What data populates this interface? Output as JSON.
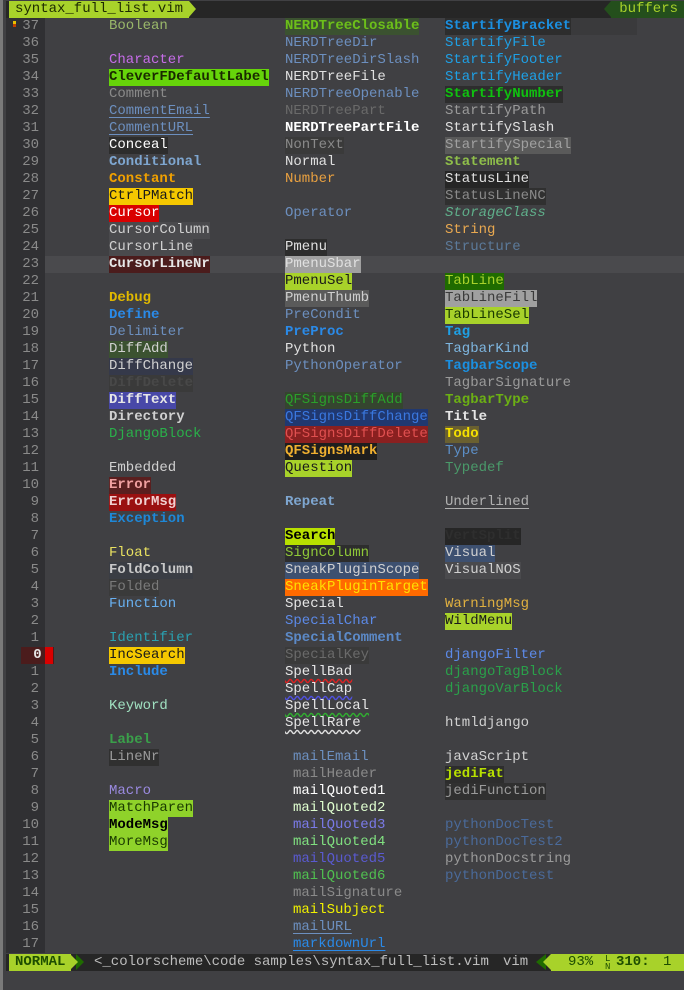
{
  "tabline": {
    "active_tab": "syntax_full_list.vim",
    "buffers_label": "buffers"
  },
  "statusline": {
    "mode": "NORMAL",
    "filepath": "<_colorscheme\\code samples\\syntax_full_list.vim",
    "filetype": "vim",
    "percent": "93%",
    "line_icon": "ln-icon",
    "line": "310:",
    "column": "1"
  },
  "colors": {
    "accent": "#a8d22a",
    "accent_dark": "#244f1c",
    "background": "#404043",
    "gutter": "#303033"
  },
  "rows": [
    {
      "lnr": "37",
      "c1": {
        "t": "Boolean",
        "fg": "#9ab86a"
      },
      "c2": {
        "t": "NERDTreeClosable",
        "fg": "#6cbf1a",
        "bg": "#3b5230",
        "b": true
      },
      "c3": {
        "t": "StartifyBracket",
        "fg": "#1b8fe0",
        "bg": "#2d2d2d",
        "b": true
      },
      "cursorline_partial": true
    },
    {
      "lnr": "36",
      "c2": {
        "t": "NERDTreeDir",
        "fg": "#6c8fbf"
      },
      "c3": {
        "t": "StartifyFile",
        "fg": "#1ea0e6"
      }
    },
    {
      "lnr": "35",
      "c1": {
        "t": "Character",
        "fg": "#c66ce8"
      },
      "c2": {
        "t": "NERDTreeDirSlash",
        "fg": "#6c8fbf"
      },
      "c3": {
        "t": "StartifyFooter",
        "fg": "#1ea0e6"
      }
    },
    {
      "lnr": "34",
      "c1": {
        "t": "CleverFDefaultLabel",
        "fg": "#1a2a00",
        "bg": "#66d40a",
        "b": true
      },
      "c2": {
        "t": "NERDTreeFile",
        "fg": "#e0e0e0"
      },
      "c3": {
        "t": "StartifyHeader",
        "fg": "#1ea0e6"
      }
    },
    {
      "lnr": "33",
      "c1": {
        "t": "Comment",
        "fg": "#8a8a8a"
      },
      "c2": {
        "t": "NERDTreeOpenable",
        "fg": "#6c8fbf"
      },
      "c3": {
        "t": "StartifyNumber",
        "fg": "#10c010",
        "bg": "#2d2d2d",
        "b": true
      }
    },
    {
      "lnr": "32",
      "c1": {
        "t": "CommentEmail",
        "fg": "#6c8fbf",
        "u": "#6c8fbf"
      },
      "c2": {
        "t": "NERDTreePart",
        "fg": "#6a6a6a"
      },
      "c3": {
        "t": "StartifyPath",
        "fg": "#9a9a9a"
      }
    },
    {
      "lnr": "31",
      "c1": {
        "t": "CommentURL",
        "fg": "#6c8fbf",
        "u": "#6c8fbf"
      },
      "c2": {
        "t": "NERDTreePartFile",
        "fg": "#ffffff",
        "b": true
      },
      "c3": {
        "t": "StartifySlash",
        "fg": "#e0e0e0"
      }
    },
    {
      "lnr": "30",
      "c1": {
        "t": "Conceal",
        "fg": "#ffffff",
        "bg": "#2d2d2d"
      },
      "c2": {
        "t": "NonText",
        "fg": "#8a8a8a",
        "bg": "#3a3a3a"
      },
      "c3": {
        "t": "StartifySpecial",
        "fg": "#a0a0a0",
        "bg": "#5a5a5a"
      }
    },
    {
      "lnr": "29",
      "c1": {
        "t": "Conditional",
        "fg": "#7ea6d0",
        "b": true
      },
      "c2": {
        "t": "Normal",
        "fg": "#e0e0e0"
      },
      "c3": {
        "t": "Statement",
        "fg": "#8fbf4a",
        "b": true
      }
    },
    {
      "lnr": "28",
      "c1": {
        "t": "Constant",
        "fg": "#f0a000",
        "b": true
      },
      "c2": {
        "t": "Number",
        "fg": "#e8a040"
      },
      "c3": {
        "t": "StatusLine",
        "fg": "#e0e0e0",
        "bg": "#262626"
      }
    },
    {
      "lnr": "27",
      "c1": {
        "t": "CtrlPMatch",
        "fg": "#1a1a1a",
        "bg": "#f5c800"
      },
      "c3": {
        "t": "StatusLineNC",
        "fg": "#8a8a8a",
        "bg": "#303030"
      }
    },
    {
      "lnr": "26",
      "c1": {
        "t": "Cursor",
        "fg": "#ffffff",
        "bg": "#d90000"
      },
      "c2": {
        "t": "Operator",
        "fg": "#6c8fbf"
      },
      "c3": {
        "t": "StorageClass",
        "fg": "#5fae8a",
        "i": true
      }
    },
    {
      "lnr": "25",
      "c1": {
        "t": "CursorColumn",
        "fg": "#d0d0d0",
        "bg": "#4a4a4d"
      },
      "c3": {
        "t": "String",
        "fg": "#e8a850"
      }
    },
    {
      "lnr": "24",
      "c1": {
        "t": "CursorLine",
        "fg": "#d0d0d0",
        "bg": "#4a4a4d"
      },
      "c2": {
        "t": "Pmenu",
        "fg": "#e0e0e0",
        "bg": "#2d2d2d"
      },
      "c3": {
        "t": "Structure",
        "fg": "#5c7a9a"
      }
    },
    {
      "lnr": "23",
      "c1": {
        "t": "CursorLineNr",
        "fg": "#e6e6e6",
        "bg": "#4b1c1c",
        "b": true
      },
      "c2": {
        "t": "PmenuSbar",
        "fg": "#e0e0e0",
        "bg": "#a0a0a0"
      },
      "cursorline": true
    },
    {
      "lnr": "22",
      "c2": {
        "t": "PmenuSel",
        "fg": "#1a1a1a",
        "bg": "#a8d22a"
      },
      "c3": {
        "t": "TabLine",
        "fg": "#a8d22a",
        "bg": "#1f6b00"
      }
    },
    {
      "lnr": "21",
      "c1": {
        "t": "Debug",
        "fg": "#e0b800",
        "b": true
      },
      "c2": {
        "t": "PmenuThumb",
        "fg": "#d0d0d0",
        "bg": "#5a5a5a"
      },
      "c3": {
        "t": "TabLineFill",
        "fg": "#3a3a3a",
        "bg": "#a0a0a0"
      }
    },
    {
      "lnr": "20",
      "c1": {
        "t": "Define",
        "fg": "#2a8ae8",
        "b": true
      },
      "c2": {
        "t": "PreCondit",
        "fg": "#6c8fbf"
      },
      "c3": {
        "t": "TabLineSel",
        "fg": "#1a3a00",
        "bg": "#a8d22a"
      }
    },
    {
      "lnr": "19",
      "c1": {
        "t": "Delimiter",
        "fg": "#6c8fbf"
      },
      "c2": {
        "t": "PreProc",
        "fg": "#2a8ae8",
        "b": true
      },
      "c3": {
        "t": "Tag",
        "fg": "#1ea0e6",
        "b": true
      }
    },
    {
      "lnr": "18",
      "c1": {
        "t": "DiffAdd",
        "fg": "#d0d0d0",
        "bg": "#3b5230"
      },
      "c2": {
        "t": "Python",
        "fg": "#e0e0e0"
      },
      "c3": {
        "t": "TagbarKind",
        "fg": "#7eb6e0"
      }
    },
    {
      "lnr": "17",
      "c1": {
        "t": "DiffChange",
        "fg": "#d0d0d0",
        "bg": "#35394a"
      },
      "c2": {
        "t": "PythonOperator",
        "fg": "#6c8fbf"
      },
      "c3": {
        "t": "TagbarScope",
        "fg": "#1b8fe0",
        "b": true
      }
    },
    {
      "lnr": "16",
      "c1": {
        "t": "DiffDelete",
        "fg": "#484848",
        "bg": "#3a3a3a",
        "b": true
      },
      "c3": {
        "t": "TagbarSignature",
        "fg": "#9a9a9a"
      }
    },
    {
      "lnr": "15",
      "c1": {
        "t": "DiffText",
        "fg": "#e6e6e6",
        "bg": "#4848a8",
        "b": true
      },
      "c2": {
        "t": "QFSignsDiffAdd",
        "fg": "#2aa02a",
        "bg": "#35452f"
      },
      "c3": {
        "t": "TagbarType",
        "fg": "#6cb014",
        "b": true
      }
    },
    {
      "lnr": "14",
      "c1": {
        "t": "Directory",
        "fg": "#d0d0d0",
        "b": true
      },
      "c2": {
        "t": "QFSignsDiffChange",
        "fg": "#3a78e0",
        "bg": "#203870"
      },
      "c3": {
        "t": "Title",
        "fg": "#e6e6e6",
        "b": true
      }
    },
    {
      "lnr": "13",
      "c1": {
        "t": "DjangoBlock",
        "fg": "#2ab04a"
      },
      "c2": {
        "t": "QFSignsDiffDelete",
        "fg": "#e05050",
        "bg": "#8a2020"
      },
      "c3": {
        "t": "Todo",
        "fg": "#f5e000",
        "bg": "#6a6030",
        "b": true
      }
    },
    {
      "lnr": "12",
      "c2": {
        "t": "QFSignsMark",
        "fg": "#f0b030",
        "bg": "#1e1e1e",
        "b": true
      },
      "c3": {
        "t": "Type",
        "fg": "#5c8fc8"
      }
    },
    {
      "lnr": "11",
      "c1": {
        "t": "Embedded",
        "fg": "#d0d0d0"
      },
      "c2": {
        "t": "Question",
        "fg": "#1a1a1a",
        "bg": "#a8d22a"
      },
      "c3": {
        "t": "Typedef",
        "fg": "#4a9a6a"
      }
    },
    {
      "lnr": "10",
      "c1": {
        "t": "Error",
        "fg": "#f0a0a0",
        "bg": "#5a1f1f",
        "b": true
      }
    },
    {
      "lnr": "9",
      "c1": {
        "t": "ErrorMsg",
        "fg": "#f0d0d0",
        "bg": "#9a1010",
        "b": true
      },
      "c2": {
        "t": "Repeat",
        "fg": "#7ea6d0",
        "b": true
      },
      "c3": {
        "t": "Underlined",
        "fg": "#b0b0b0",
        "u": "#b0b0b0"
      }
    },
    {
      "lnr": "8",
      "c1": {
        "t": "Exception",
        "fg": "#1e88d8",
        "b": true
      }
    },
    {
      "lnr": "7",
      "c2": {
        "t": "Search",
        "fg": "#000000",
        "bg": "#b8e000",
        "b": true
      },
      "c3": {
        "t": "VertSplit",
        "fg": "#2e2e2e",
        "bg": "#262626",
        "b": true
      }
    },
    {
      "lnr": "6",
      "c1": {
        "t": "Float",
        "fg": "#e8e060"
      },
      "c2": {
        "t": "SignColumn",
        "fg": "#8fc838",
        "bg": "#2d2d2d"
      },
      "c3": {
        "t": "Visual",
        "fg": "#d0d0d0",
        "bg": "#3d5070"
      }
    },
    {
      "lnr": "5",
      "c1": {
        "t": "FoldColumn",
        "fg": "#c8c8c8",
        "bg": "#3a3d44",
        "b": true
      },
      "c2": {
        "t": "SneakPluginScope",
        "fg": "#d0d0d0",
        "bg": "#3d5070"
      },
      "c3": {
        "t": "VisualNOS",
        "fg": "#d0d0d0",
        "bg": "#4a4a4d"
      }
    },
    {
      "lnr": "4",
      "c1": {
        "t": "Folded",
        "fg": "#7a7a7a",
        "bg": "#3a3a3a"
      },
      "c2": {
        "t": "SneakPluginTarget",
        "fg": "#ffe000",
        "bg": "#ff6a00"
      }
    },
    {
      "lnr": "3",
      "c1": {
        "t": "Function",
        "fg": "#68b0f0"
      },
      "c2": {
        "t": "Special",
        "fg": "#e6e6e6"
      },
      "c3": {
        "t": "WarningMsg",
        "fg": "#e0b040"
      }
    },
    {
      "lnr": "2",
      "c2": {
        "t": "SpecialChar",
        "fg": "#5c8ae8"
      },
      "c3": {
        "t": "WildMenu",
        "fg": "#1a1a1a",
        "bg": "#a8d22a"
      }
    },
    {
      "lnr": "1",
      "c1": {
        "t": "Identifier",
        "fg": "#2aa0b0"
      },
      "c2": {
        "t": "SpecialComment",
        "fg": "#5c8ac8",
        "b": true
      }
    },
    {
      "lnr": "0",
      "current": true,
      "c1": {
        "t": "IncSearch",
        "fg": "#1a1a1a",
        "bg": "#f5c800"
      },
      "c2": {
        "t": "SpecialKey",
        "fg": "#6a6a6a",
        "bg": "#3a3a3a"
      },
      "c3": {
        "t": "djangoFilter",
        "fg": "#5c8ae8"
      }
    },
    {
      "lnr": "1",
      "c1": {
        "t": "Include",
        "fg": "#2a8ae8",
        "b": true
      },
      "c2": {
        "t": "SpellBad",
        "fg": "#e6e6e6",
        "wavy": "red"
      },
      "c3": {
        "t": "djangoTagBlock",
        "fg": "#2aa04a"
      }
    },
    {
      "lnr": "2",
      "c2": {
        "t": "SpellCap",
        "fg": "#e6e6e6",
        "wavy": "blue"
      },
      "c3": {
        "t": "djangoVarBlock",
        "fg": "#2aa04a"
      }
    },
    {
      "lnr": "3",
      "c1": {
        "t": "Keyword",
        "fg": "#a0e0c0"
      },
      "c2": {
        "t": "SpellLocal",
        "fg": "#e6e6e6",
        "wavy": "green"
      }
    },
    {
      "lnr": "4",
      "c2": {
        "t": "SpellRare",
        "fg": "#e6e6e6",
        "wavy": "white"
      },
      "c3": {
        "t": "htmldjango",
        "fg": "#d0d0d0"
      }
    },
    {
      "lnr": "5",
      "c1": {
        "t": "Label",
        "fg": "#3aa04a",
        "b": true
      }
    },
    {
      "lnr": "6",
      "c1": {
        "t": "LineNr",
        "fg": "#9a9a9a",
        "bg": "#303030"
      },
      "c2b": {
        "t": "mailEmail",
        "fg": "#6c8fbf"
      },
      "c3": {
        "t": "javaScript",
        "fg": "#d0d0d0"
      }
    },
    {
      "lnr": "7",
      "c2b": {
        "t": "mailHeader",
        "fg": "#8a8a8a"
      },
      "c3": {
        "t": "jediFat",
        "fg": "#b8e000",
        "bg": "#2d2d2d",
        "b": true
      }
    },
    {
      "lnr": "8",
      "c1": {
        "t": "Macro",
        "fg": "#9a8ae0"
      },
      "c2b": {
        "t": "mailQuoted1",
        "fg": "#ffffff"
      },
      "c3": {
        "t": "jediFunction",
        "fg": "#9a9a9a",
        "bg": "#303030"
      }
    },
    {
      "lnr": "9",
      "c1": {
        "t": "MatchParen",
        "fg": "#1a3a00",
        "bg": "#8fd22a"
      },
      "c2b": {
        "t": "mailQuoted2",
        "fg": "#e0ffd0"
      }
    },
    {
      "lnr": "10",
      "c1": {
        "t": "ModeMsg",
        "fg": "#000000",
        "bg": "#8fd22a",
        "b": true
      },
      "c2b": {
        "t": "mailQuoted3",
        "fg": "#7a7ae8"
      },
      "c3": {
        "t": "pythonDocTest",
        "fg": "#4a6a9a"
      }
    },
    {
      "lnr": "11",
      "c1": {
        "t": "MoreMsg",
        "fg": "#1a3a00",
        "bg": "#8fd22a"
      },
      "c2b": {
        "t": "mailQuoted4",
        "fg": "#80e080"
      },
      "c3": {
        "t": "pythonDocTest2",
        "fg": "#4a6a9a"
      }
    },
    {
      "lnr": "12",
      "c2b": {
        "t": "mailQuoted5",
        "fg": "#5a5ad0"
      },
      "c3": {
        "t": "pythonDocstring",
        "fg": "#9a9a9a"
      }
    },
    {
      "lnr": "13",
      "c2b": {
        "t": "mailQuoted6",
        "fg": "#50c050"
      },
      "c3": {
        "t": "pythonDoctest",
        "fg": "#4a6a9a"
      }
    },
    {
      "lnr": "14",
      "c2b": {
        "t": "mailSignature",
        "fg": "#8a8a8a"
      }
    },
    {
      "lnr": "15",
      "c2b": {
        "t": "mailSubject",
        "fg": "#f0f000"
      }
    },
    {
      "lnr": "16",
      "c2b": {
        "t": "mailURL",
        "fg": "#6c8fbf",
        "u": "#6c8fbf"
      }
    },
    {
      "lnr": "17",
      "c2b": {
        "t": "markdownUrl",
        "fg": "#2a8ae8",
        "u": "#2a8ae8"
      }
    }
  ]
}
